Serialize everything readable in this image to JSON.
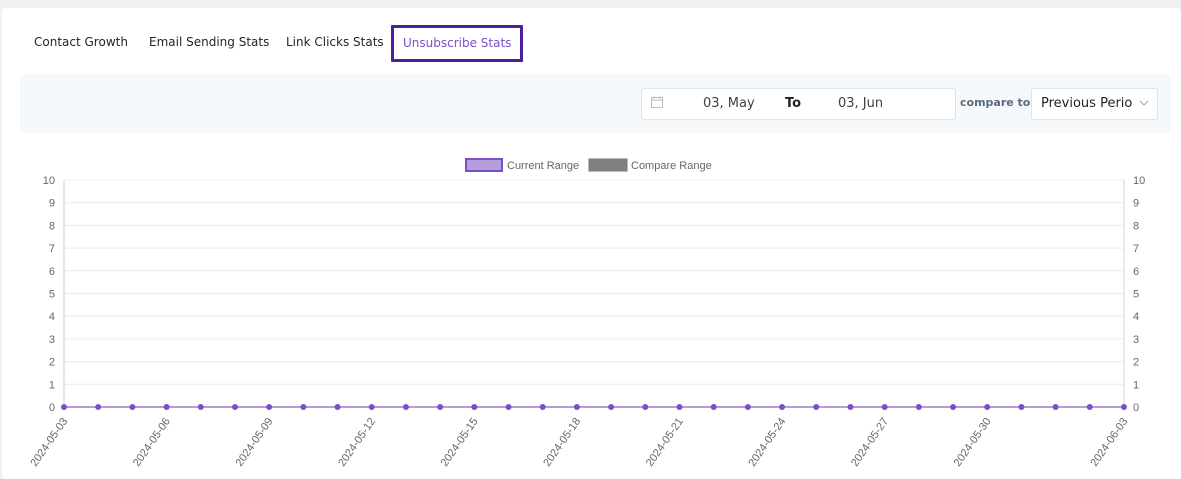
{
  "tabs": [
    {
      "label": "Contact Growth",
      "active": false
    },
    {
      "label": "Email Sending Stats",
      "active": false
    },
    {
      "label": "Link Clicks Stats",
      "active": false
    },
    {
      "label": "Unsubscribe Stats",
      "active": true
    }
  ],
  "filter": {
    "date_from": "03, May",
    "to_label": "To",
    "date_to": "03, Jun",
    "compare_label": "compare to",
    "compare_value": "Previous Period"
  },
  "colors": {
    "accent": "#7b4fc9",
    "current_fill": "#b39ddb",
    "compare_fill": "#808080"
  },
  "chart_data": {
    "type": "line",
    "x": [
      "2024-05-03",
      "2024-05-04",
      "2024-05-05",
      "2024-05-06",
      "2024-05-07",
      "2024-05-08",
      "2024-05-09",
      "2024-05-10",
      "2024-05-11",
      "2024-05-12",
      "2024-05-13",
      "2024-05-14",
      "2024-05-15",
      "2024-05-16",
      "2024-05-17",
      "2024-05-18",
      "2024-05-19",
      "2024-05-20",
      "2024-05-21",
      "2024-05-22",
      "2024-05-23",
      "2024-05-24",
      "2024-05-25",
      "2024-05-26",
      "2024-05-27",
      "2024-05-28",
      "2024-05-29",
      "2024-05-30",
      "2024-05-31",
      "2024-06-01",
      "2024-06-02",
      "2024-06-03"
    ],
    "x_tick_labels_shown": [
      "2024-05-03",
      "2024-05-06",
      "2024-05-09",
      "2024-05-12",
      "2024-05-15",
      "2024-05-18",
      "2024-05-21",
      "2024-05-24",
      "2024-05-27",
      "2024-05-30",
      "2024-06-03"
    ],
    "series": [
      {
        "name": "Current Range",
        "values": [
          0,
          0,
          0,
          0,
          0,
          0,
          0,
          0,
          0,
          0,
          0,
          0,
          0,
          0,
          0,
          0,
          0,
          0,
          0,
          0,
          0,
          0,
          0,
          0,
          0,
          0,
          0,
          0,
          0,
          0,
          0,
          0
        ]
      }
    ],
    "legend": [
      "Current Range",
      "Compare Range"
    ],
    "ylim": [
      0,
      10
    ],
    "yticks": [
      0,
      1,
      2,
      3,
      4,
      5,
      6,
      7,
      8,
      9,
      10
    ],
    "grid": true,
    "legend_position": "top"
  }
}
